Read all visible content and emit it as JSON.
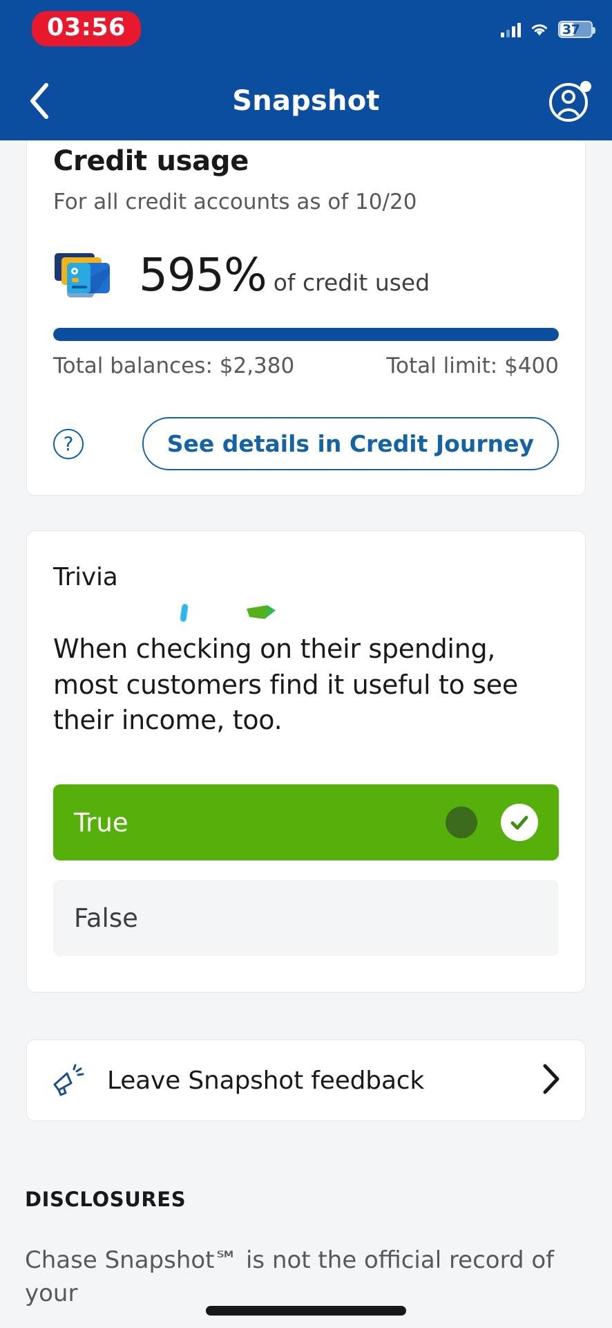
{
  "status_bar": {
    "time": "03:56",
    "battery_percent": "37",
    "icons": [
      "cellular-signal-icon",
      "wifi-icon",
      "battery-icon"
    ]
  },
  "nav": {
    "title": "Snapshot",
    "back_icon": "chevron-left-icon",
    "profile_icon": "user-avatar-icon"
  },
  "credit_usage": {
    "title": "Credit usage",
    "subtitle": "For all credit accounts as of 10/20",
    "icon": "credit-cards-icon",
    "percent": "595%",
    "percent_label": "of credit used",
    "progress_fill_percent": 100,
    "total_balances": "Total balances: $2,380",
    "total_limit": "Total limit: $400",
    "help_icon": "question-mark-circle-icon",
    "help_glyph": "?",
    "cta_label": "See details in Credit Journey",
    "accent_color": "#0b4d9e",
    "link_color": "#1464a5"
  },
  "trivia": {
    "title": "Trivia",
    "question": "When checking on their spending, most customers find it useful to see their income, too.",
    "answers": [
      {
        "label": "True",
        "selected": true,
        "check_icon": "check-circle-icon"
      },
      {
        "label": "False",
        "selected": false
      }
    ],
    "selected_color": "#55b10a"
  },
  "feedback": {
    "icon": "megaphone-icon",
    "label": "Leave Snapshot feedback",
    "chevron": "chevron-right-icon"
  },
  "disclosures": {
    "heading": "DISCLOSURES",
    "body": "Chase Snapshot℠ is not the official record of your"
  }
}
